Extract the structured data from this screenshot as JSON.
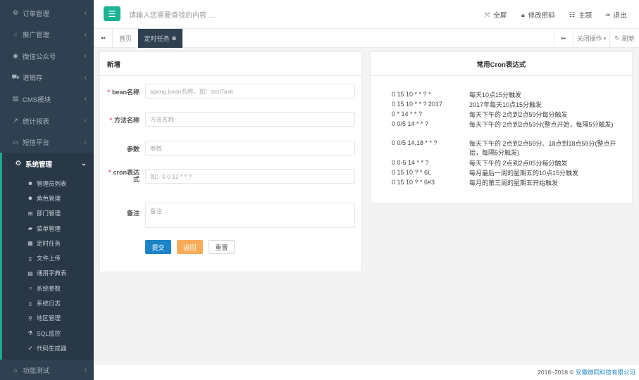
{
  "sidebar": {
    "items_top": [
      {
        "label": "订单管理",
        "icon": "gear-icon"
      },
      {
        "label": "推广管理",
        "icon": "hand-icon"
      },
      {
        "label": "微信公众号",
        "icon": "wechat-icon"
      },
      {
        "label": "进销存",
        "icon": "truck-icon"
      },
      {
        "label": "CMS模块",
        "icon": "book-icon"
      },
      {
        "label": "统计报表",
        "icon": "chart-icon"
      },
      {
        "label": "短信平台",
        "icon": "monitor-icon"
      }
    ],
    "active_group": {
      "label": "系统管理",
      "icon": "gear-icon"
    },
    "sub_items": [
      {
        "label": "管理员列表",
        "icon": "user-icon"
      },
      {
        "label": "角色管理",
        "icon": "user-icon"
      },
      {
        "label": "部门管理",
        "icon": "sitemap-icon"
      },
      {
        "label": "菜单管理",
        "icon": "folder-icon"
      },
      {
        "label": "定时任务",
        "icon": "calendar-icon"
      },
      {
        "label": "文件上传",
        "icon": "file-icon"
      },
      {
        "label": "通用字典表",
        "icon": "book-icon"
      },
      {
        "label": "系统参数",
        "icon": "circle-icon"
      },
      {
        "label": "系统日志",
        "icon": "file-icon"
      },
      {
        "label": "地区管理",
        "icon": "map-pin-icon"
      },
      {
        "label": "SQL监控",
        "icon": "flask-icon"
      },
      {
        "label": "代码生成器",
        "icon": "rocket-icon"
      }
    ],
    "bottom_item": {
      "label": "功能测试",
      "icon": "home-icon"
    }
  },
  "topbar": {
    "search_placeholder": "请输入您需要查找的内容 …",
    "fullscreen": "全屏",
    "change_password": "修改密码",
    "theme": "主题",
    "logout": "退出"
  },
  "tabs": {
    "home": "首页",
    "active": "定时任务",
    "close_actions": "关闭操作",
    "refresh": "刷新"
  },
  "form": {
    "title": "新增",
    "bean_label": "bean名称",
    "bean_placeholder": "spring bean名称，如：testTask",
    "method_label": "方法名称",
    "method_placeholder": "方法名称",
    "params_label": "参数",
    "params_placeholder": "参数",
    "cron_label_1": "cron表达",
    "cron_label_2": "式",
    "cron_placeholder": "如：0 0 12 * * ?",
    "remark_label": "备注",
    "remark_placeholder": "备注",
    "submit": "提交",
    "back": "返回",
    "reset": "重置"
  },
  "cron_panel": {
    "title": "常用Cron表达式",
    "rows": [
      {
        "expr": "0 15 10 * * ? *",
        "desc": "每天10点15分触发"
      },
      {
        "expr": "0 15 10 * * ? 2017",
        "desc": "2017年每天10点15分触发"
      },
      {
        "expr": "0 * 14 * * ?",
        "desc": "每天下午的 2点到2点59分每分触发"
      },
      {
        "expr": "0 0/5 14 * * ?",
        "desc": "每天下午的 2点到2点59分(整点开始，每隔5分触发)"
      },
      {
        "expr": "0 0/5 14,18 * * ?",
        "desc": "每天下午的 2点到2点59分、18点到18点59分(整点开始，每隔5分触发)"
      },
      {
        "expr": "0 0-5 14 * * ?",
        "desc": "每天下午的 2点到2点05分每分触发"
      },
      {
        "expr": "0 15 10 ? * 6L",
        "desc": "每月最后一周的星期五的10点15分触发"
      },
      {
        "expr": "0 15 10 ? * 6#3",
        "desc": "每月的第三周的星期五开始触发"
      }
    ]
  },
  "footer": {
    "prefix": "2018~2018 © ",
    "company": "安徽微同科技有限公司"
  },
  "colors": {
    "sidebar_bg": "#2f4050",
    "accent": "#1ab394",
    "primary": "#1c84c6",
    "warning": "#f8ac59",
    "required": "#ed5565"
  }
}
